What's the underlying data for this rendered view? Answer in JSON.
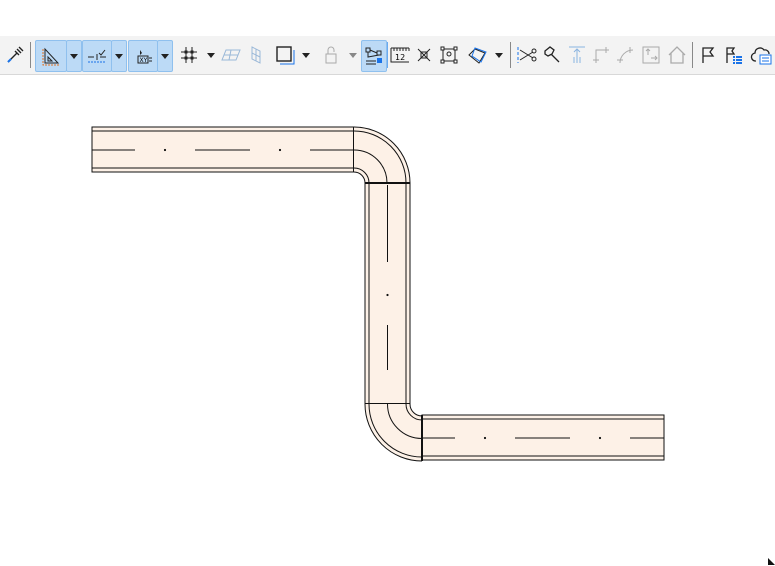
{
  "toolbar": {
    "items": [
      {
        "name": "pipette-icon",
        "disabled": false
      },
      {
        "name": "angle-ruler-icon",
        "active": true
      },
      {
        "name": "guideline-icon",
        "active": true
      },
      {
        "name": "xy-coordinates-icon",
        "active": true
      },
      {
        "name": "grid-snap-icon"
      },
      {
        "name": "plane-icon",
        "disabled": true
      },
      {
        "name": "vertical-plane-icon",
        "disabled": true
      },
      {
        "name": "layer-square-icon"
      },
      {
        "name": "lock-icon",
        "disabled": true
      },
      {
        "name": "snap-guide-icon",
        "active": true
      },
      {
        "name": "ruler-icon"
      },
      {
        "name": "cross-icon"
      },
      {
        "name": "group-select-icon"
      },
      {
        "name": "3d-box-icon"
      },
      {
        "name": "scissors-icon"
      },
      {
        "name": "hammer-icon"
      },
      {
        "name": "elevate-icon",
        "disabled": true
      },
      {
        "name": "corner-icon",
        "disabled": true
      },
      {
        "name": "arc-corner-icon",
        "disabled": true
      },
      {
        "name": "resize-icon",
        "disabled": true
      },
      {
        "name": "house-icon",
        "disabled": true
      },
      {
        "name": "flag-icon"
      },
      {
        "name": "flag-list-icon"
      },
      {
        "name": "cloud-list-icon"
      }
    ]
  },
  "colors": {
    "road_fill": "#fdf1e7",
    "accent": "#1a73e8",
    "active_bg": "#bcdaf6"
  }
}
